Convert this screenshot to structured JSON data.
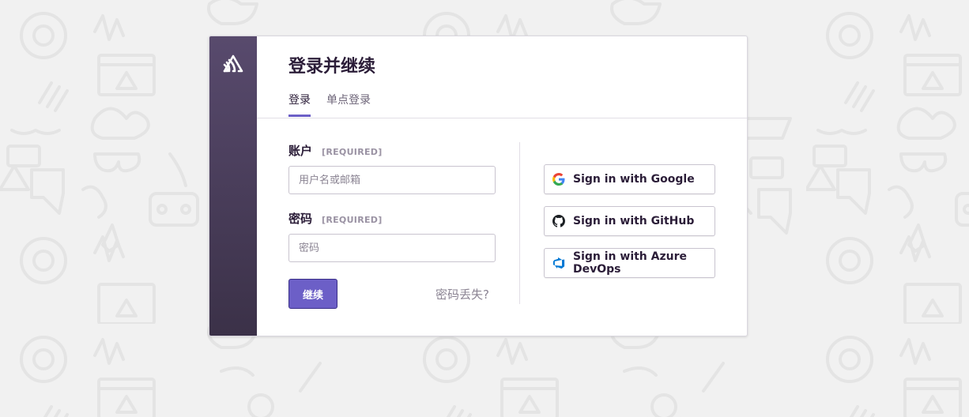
{
  "header": {
    "title": "登录并继续",
    "tabs": [
      {
        "label": "登录",
        "active": true
      },
      {
        "label": "单点登录",
        "active": false
      }
    ]
  },
  "form": {
    "account": {
      "label": "账户",
      "required_tag": "[REQUIRED]",
      "placeholder": "用户名或邮箱",
      "value": ""
    },
    "password": {
      "label": "密码",
      "required_tag": "[REQUIRED]",
      "placeholder": "密码",
      "value": ""
    },
    "submit_label": "继续",
    "lost_password_label": "密码丢失?"
  },
  "social": [
    {
      "label": "Sign in with Google",
      "icon": "google-icon"
    },
    {
      "label": "Sign in with GitHub",
      "icon": "github-icon"
    },
    {
      "label": "Sign in with Azure DevOps",
      "icon": "azure-devops-icon"
    }
  ],
  "colors": {
    "sidebar_top": "#584a6d",
    "sidebar_bottom": "#3b3148",
    "accent": "#6c5fc7",
    "title_text": "#2b1d38",
    "background": "#f1f1f1"
  }
}
